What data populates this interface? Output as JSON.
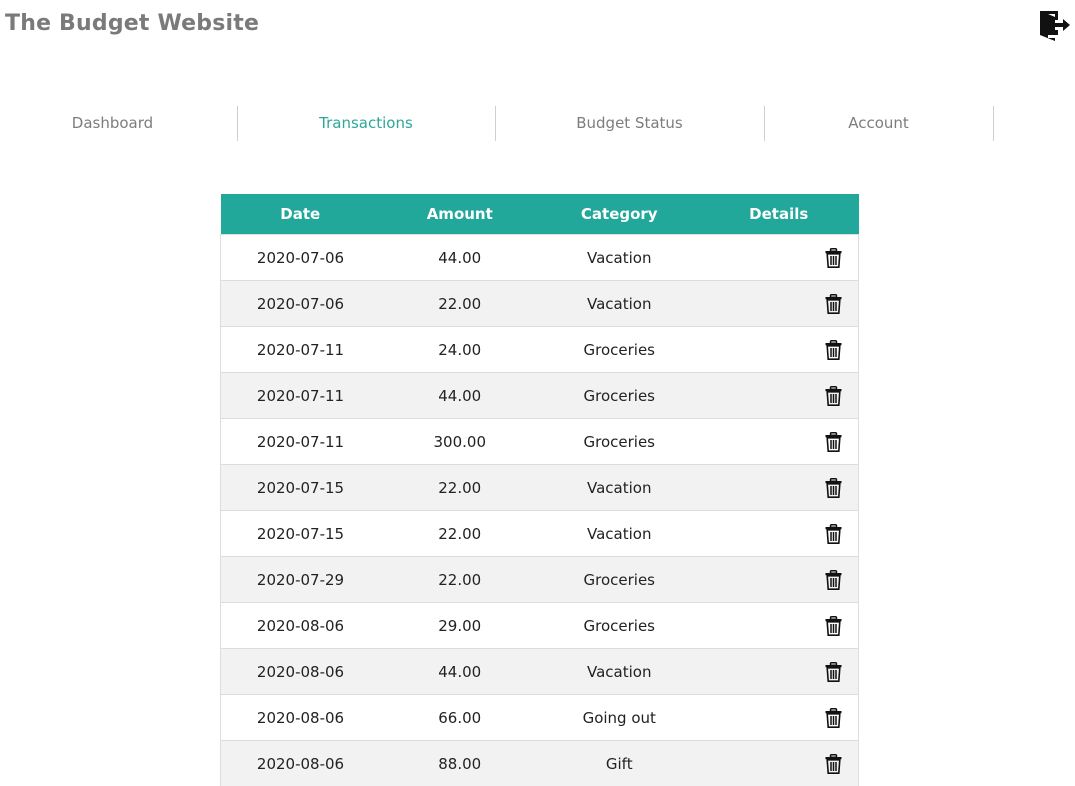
{
  "header": {
    "title": "The Budget Website",
    "logout_icon": "logout-door-icon"
  },
  "nav": {
    "active": "Transactions",
    "accent_color": "#2ca89a",
    "items": [
      {
        "label": "Dashboard"
      },
      {
        "label": "Transactions"
      },
      {
        "label": "Budget Status"
      },
      {
        "label": "Account"
      }
    ]
  },
  "table": {
    "header_color": "#22a89a",
    "columns": [
      "Date",
      "Amount",
      "Category",
      "Details"
    ],
    "delete_icon": "trash-icon",
    "rows": [
      {
        "date": "2020-07-06",
        "amount": "44.00",
        "category": "Vacation"
      },
      {
        "date": "2020-07-06",
        "amount": "22.00",
        "category": "Vacation"
      },
      {
        "date": "2020-07-11",
        "amount": "24.00",
        "category": "Groceries"
      },
      {
        "date": "2020-07-11",
        "amount": "44.00",
        "category": "Groceries"
      },
      {
        "date": "2020-07-11",
        "amount": "300.00",
        "category": "Groceries"
      },
      {
        "date": "2020-07-15",
        "amount": "22.00",
        "category": "Vacation"
      },
      {
        "date": "2020-07-15",
        "amount": "22.00",
        "category": "Vacation"
      },
      {
        "date": "2020-07-29",
        "amount": "22.00",
        "category": "Groceries"
      },
      {
        "date": "2020-08-06",
        "amount": "29.00",
        "category": "Groceries"
      },
      {
        "date": "2020-08-06",
        "amount": "44.00",
        "category": "Vacation"
      },
      {
        "date": "2020-08-06",
        "amount": "66.00",
        "category": "Going out"
      },
      {
        "date": "2020-08-06",
        "amount": "88.00",
        "category": "Gift"
      }
    ]
  }
}
